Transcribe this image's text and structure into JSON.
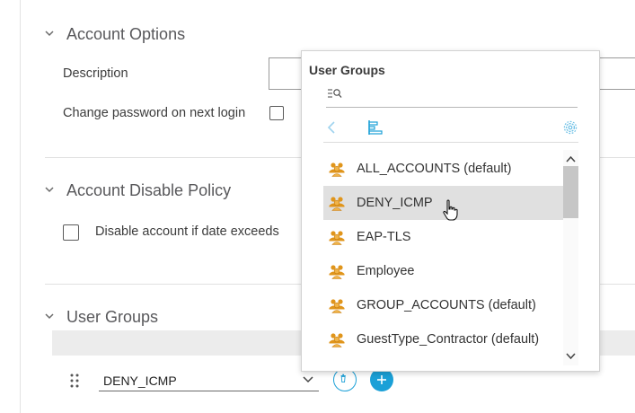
{
  "sections": {
    "account_options": {
      "title": "Account Options",
      "description_label": "Description",
      "description_value": "",
      "change_password_label": "Change password on next login",
      "change_password_checked": false
    },
    "account_disable": {
      "title": "Account Disable Policy",
      "disable_label": "Disable account if date exceeds",
      "disable_checked": false
    },
    "user_groups": {
      "title": "User Groups",
      "selected_group": "DENY_ICMP"
    }
  },
  "popover": {
    "title": "User Groups",
    "search_value": "",
    "items": [
      {
        "label": "ALL_ACCOUNTS (default)",
        "selected": false
      },
      {
        "label": "DENY_ICMP",
        "selected": true
      },
      {
        "label": "EAP-TLS",
        "selected": false
      },
      {
        "label": "Employee",
        "selected": false
      },
      {
        "label": "GROUP_ACCOUNTS (default)",
        "selected": false
      },
      {
        "label": "GuestType_Contractor (default)",
        "selected": false
      }
    ]
  },
  "colors": {
    "accent": "#1ba0d7",
    "group_icon": "#e0951b",
    "selected_row": "#e0e0e0"
  },
  "icons": [
    "chevron-down-icon",
    "search-filter-icon",
    "back-arrow-icon",
    "hierarchy-icon",
    "gear-icon",
    "user-group-icon",
    "trash-icon",
    "plus-icon",
    "drag-handle-icon",
    "hand-cursor-icon"
  ]
}
